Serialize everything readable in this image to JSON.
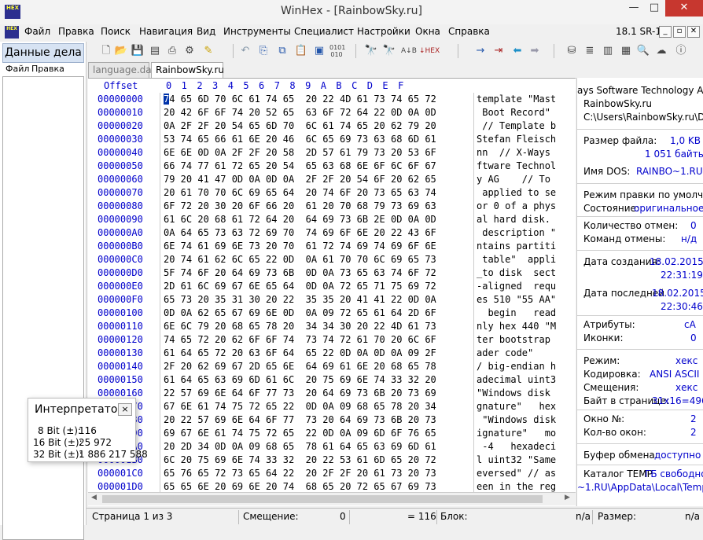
{
  "window": {
    "title": "WinHex - [RainbowSky.ru]",
    "logo": "HEX",
    "min": "—",
    "max": "□",
    "close": "✕"
  },
  "menu": {
    "items": [
      "Файл",
      "Правка",
      "Поиск",
      "Навигация",
      "Вид",
      "Инструменты",
      "Специалист",
      "Настройки",
      "Окна",
      "Справка"
    ],
    "version": "18.1 SR-1"
  },
  "left_panel": {
    "title": "Данные дела",
    "menu": [
      "Файл",
      "Правка"
    ]
  },
  "tabs": [
    "language.dat",
    "RainbowSky.ru"
  ],
  "hex": {
    "offset_header": "Offset",
    "column_header": "0  1  2  3  4  5  6  7  8  9  A  B  C  D  E  F",
    "rows": [
      {
        "off": "00000000",
        "hex": "74 65 6D 70 6C 61 74 65  20 22 4D 61 73 74 65 72",
        "ascii": "template \"Mast"
      },
      {
        "off": "00000010",
        "hex": "20 42 6F 6F 74 20 52 65  63 6F 72 64 22 0D 0A 0D",
        "ascii": " Boot Record\""
      },
      {
        "off": "00000020",
        "hex": "0A 2F 2F 20 54 65 6D 70  6C 61 74 65 20 62 79 20",
        "ascii": " // Template b"
      },
      {
        "off": "00000030",
        "hex": "53 74 65 66 61 6E 20 46  6C 65 69 73 63 68 6D 61",
        "ascii": "Stefan Fleisch"
      },
      {
        "off": "00000040",
        "hex": "6E 6E 0D 0A 2F 2F 20 58  2D 57 61 79 73 20 53 6F",
        "ascii": "nn  // X-Ways"
      },
      {
        "off": "00000050",
        "hex": "66 74 77 61 72 65 20 54  65 63 68 6E 6F 6C 6F 67",
        "ascii": "ftware Technol"
      },
      {
        "off": "00000060",
        "hex": "79 20 41 47 0D 0A 0D 0A  2F 2F 20 54 6F 20 62 65",
        "ascii": "y AG    // To"
      },
      {
        "off": "00000070",
        "hex": "20 61 70 70 6C 69 65 64  20 74 6F 20 73 65 63 74",
        "ascii": " applied to se"
      },
      {
        "off": "00000080",
        "hex": "6F 72 20 30 20 6F 66 20  61 20 70 68 79 73 69 63",
        "ascii": "or 0 of a phys"
      },
      {
        "off": "00000090",
        "hex": "61 6C 20 68 61 72 64 20  64 69 73 6B 2E 0D 0A 0D",
        "ascii": "al hard disk."
      },
      {
        "off": "000000A0",
        "hex": "0A 64 65 73 63 72 69 70  74 69 6F 6E 20 22 43 6F",
        "ascii": " description \""
      },
      {
        "off": "000000B0",
        "hex": "6E 74 61 69 6E 73 20 70  61 72 74 69 74 69 6F 6E",
        "ascii": "ntains partiti"
      },
      {
        "off": "000000C0",
        "hex": "20 74 61 62 6C 65 22 0D  0A 61 70 70 6C 69 65 73",
        "ascii": " table\"  appli"
      },
      {
        "off": "000000D0",
        "hex": "5F 74 6F 20 64 69 73 6B  0D 0A 73 65 63 74 6F 72",
        "ascii": "_to disk  sect"
      },
      {
        "off": "000000E0",
        "hex": "2D 61 6C 69 67 6E 65 64  0D 0A 72 65 71 75 69 72",
        "ascii": "-aligned  requ"
      },
      {
        "off": "000000F0",
        "hex": "65 73 20 35 31 30 20 22  35 35 20 41 41 22 0D 0A",
        "ascii": "es 510 \"55 AA\""
      },
      {
        "off": "00000100",
        "hex": "0D 0A 62 65 67 69 6E 0D  0A 09 72 65 61 64 2D 6F",
        "ascii": "  begin   read"
      },
      {
        "off": "00000110",
        "hex": "6E 6C 79 20 68 65 78 20  34 34 30 20 22 4D 61 73",
        "ascii": "nly hex 440 \"M"
      },
      {
        "off": "00000120",
        "hex": "74 65 72 20 62 6F 6F 74  73 74 72 61 70 20 6C 6F",
        "ascii": "ter bootstrap"
      },
      {
        "off": "00000130",
        "hex": "61 64 65 72 20 63 6F 64  65 22 0D 0A 0D 0A 09 2F",
        "ascii": "ader code\""
      },
      {
        "off": "00000140",
        "hex": "2F 20 62 69 67 2D 65 6E  64 69 61 6E 20 68 65 78",
        "ascii": "/ big-endian h"
      },
      {
        "off": "00000150",
        "hex": "61 64 65 63 69 6D 61 6C  20 75 69 6E 74 33 32 20",
        "ascii": "adecimal uint3"
      },
      {
        "off": "00000160",
        "hex": "22 57 69 6E 64 6F 77 73  20 64 69 73 6B 20 73 69",
        "ascii": "\"Windows disk"
      },
      {
        "off": "00000170",
        "hex": "67 6E 61 74 75 72 65 22  0D 0A 09 68 65 78 20 34",
        "ascii": "gnature\"   hex"
      },
      {
        "off": "00000180",
        "hex": "20 22 57 69 6E 64 6F 77  73 20 64 69 73 6B 20 73",
        "ascii": " \"Windows disk"
      },
      {
        "off": "00000190",
        "hex": "69 67 6E 61 74 75 72 65  22 0D 0A 09 6D 6F 76 65",
        "ascii": "ignature\"   mo"
      },
      {
        "off": "000001A0",
        "hex": "20 2D 34 0D 0A 09 68 65  78 61 64 65 63 69 6D 61",
        "ascii": " -4   hexadeci"
      },
      {
        "off": "000001B0",
        "hex": "6C 20 75 69 6E 74 33 32  20 22 53 61 6D 65 20 72",
        "ascii": "l uint32 \"Same"
      },
      {
        "off": "000001C0",
        "hex": "65 76 65 72 73 65 64 22  20 2F 2F 20 61 73 20 73",
        "ascii": "eversed\" // as"
      },
      {
        "off": "000001D0",
        "hex": "65 65 6E 20 69 6E 20 74  68 65 20 72 65 67 69 73",
        "ascii": "een in the reg"
      }
    ]
  },
  "info": {
    "company": "ays Software Technology AG",
    "filename": "RainbowSky.ru",
    "path": "C:\\Users\\RainbowSky.ru\\Des",
    "file_size_label": "Размер файла:",
    "file_size_kb": "1,0 KB",
    "file_size_bytes": "1 051 байты",
    "dos_name_label": "Имя DOS:",
    "dos_name": "RAINBO~1.RU",
    "edit_mode_label": "Режим правки по умолчан",
    "state_label": "Состояние:",
    "state_value": "оригинальное",
    "undo_count_label": "Количество отмен:",
    "undo_count": "0",
    "undo_cmd_label": "Команд отмены:",
    "undo_cmd": "н/д",
    "created_label": "Дата создания:",
    "created_date": "18.02.2015",
    "created_time": "22:31:19",
    "modified_label": "Дата последней",
    "modified_date": "18.02.2015",
    "modified_time": "22:30:46",
    "attrs_label": "Атрибуты:",
    "attrs_value": "cA",
    "icons_label": "Иконки:",
    "icons_value": "0",
    "mode_label": "Режим:",
    "mode_value": "хекс",
    "encoding_label": "Кодировка:",
    "encoding_value": "ANSI ASCII",
    "offsets_label": "Смещения:",
    "offsets_value": "хекс",
    "bytes_per_page_label": "Байт в странице:",
    "bytes_per_page_value": "31x16=496",
    "window_no_label": "Окно №:",
    "window_no_value": "2",
    "window_count_label": "Кол-во окон:",
    "window_count_value": "2",
    "clipboard_label": "Буфер обмена:",
    "clipboard_value": "доступно",
    "temp_label": "Каталог TEMP",
    "temp_free": "ГБ свободно",
    "temp_path": "~1.RU\\AppData\\Local\\Temp"
  },
  "interpreter": {
    "title": "Интерпретато...",
    "close": "×",
    "rows": [
      {
        "label": "8 Bit (±):",
        "value": "116"
      },
      {
        "label": "16 Bit (±):",
        "value": "25 972"
      },
      {
        "label": "32 Bit (±):",
        "value": "1 886 217 588"
      }
    ]
  },
  "status": {
    "page": "Страница 1 из 3",
    "offset_label": "Смещение:",
    "offset_value": "0",
    "eq_value": "= 116",
    "block_label": "Блок:",
    "block_value": "n/a",
    "size_label": "Размер:",
    "size_value": "n/a"
  }
}
